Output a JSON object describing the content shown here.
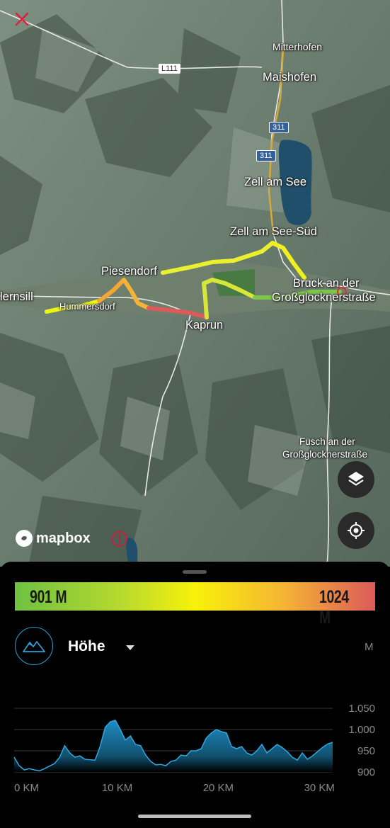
{
  "map": {
    "labels": {
      "mitterhofen": "Mitterhofen",
      "maishofen": "Maishofen",
      "zell_am_see": "Zell am See",
      "zell_am_see_sued": "Zell am See-Süd",
      "piesendorf": "Piesendorf",
      "hummersdorf": "Hummersdorf",
      "niedernsill": "lernsill",
      "kaprun": "Kaprun",
      "bruck": "Bruck an der",
      "bruck2": "Großglocknerstraße",
      "fusch": "Fusch an der",
      "fusch2": "Großglocknerstraße"
    },
    "roads": {
      "l111": "L111",
      "b311a": "311",
      "b311b": "311"
    },
    "attribution": "mapbox"
  },
  "elevation": {
    "min_label": "901 M",
    "max_label": "1024 M",
    "metric": "Höhe",
    "unit": "M",
    "colors": {
      "accent": "#2b9ed6",
      "low": "#6fc143",
      "mid": "#f8f10a",
      "high": "#dc5a5a"
    }
  },
  "chart_data": {
    "type": "area",
    "x_unit": "KM",
    "xlim": [
      0,
      31.5
    ],
    "ylim": [
      900,
      1050
    ],
    "x_ticks": [
      "0 KM",
      "10 KM",
      "20 KM",
      "30 KM"
    ],
    "y_ticks": [
      "1.050",
      "1.000",
      "950",
      "900"
    ],
    "x": [
      0,
      0.5,
      1,
      1.5,
      2,
      2.5,
      3,
      3.5,
      4,
      4.5,
      5,
      5.5,
      6,
      6.5,
      7,
      7.5,
      8,
      8.5,
      9,
      9.5,
      10,
      10.5,
      11,
      11.5,
      12,
      12.5,
      13,
      13.5,
      14,
      14.5,
      15,
      15.5,
      16,
      16.5,
      17,
      17.5,
      18,
      18.5,
      19,
      19.5,
      20,
      20.5,
      21,
      21.5,
      22,
      22.5,
      23,
      23.5,
      24,
      24.5,
      25,
      25.5,
      26,
      26.5,
      27,
      27.5,
      28,
      28.5,
      29,
      29.5,
      30,
      30.5,
      31,
      31.5
    ],
    "y": [
      935,
      915,
      905,
      908,
      905,
      903,
      908,
      914,
      920,
      935,
      962,
      945,
      935,
      938,
      930,
      929,
      928,
      960,
      1005,
      1018,
      1022,
      1000,
      975,
      985,
      965,
      962,
      940,
      925,
      917,
      918,
      915,
      925,
      928,
      940,
      938,
      950,
      950,
      955,
      980,
      992,
      1000,
      995,
      992,
      960,
      955,
      960,
      945,
      940,
      950,
      965,
      945,
      955,
      965,
      958,
      948,
      935,
      928,
      945,
      930,
      938,
      948,
      958,
      966,
      970
    ]
  }
}
